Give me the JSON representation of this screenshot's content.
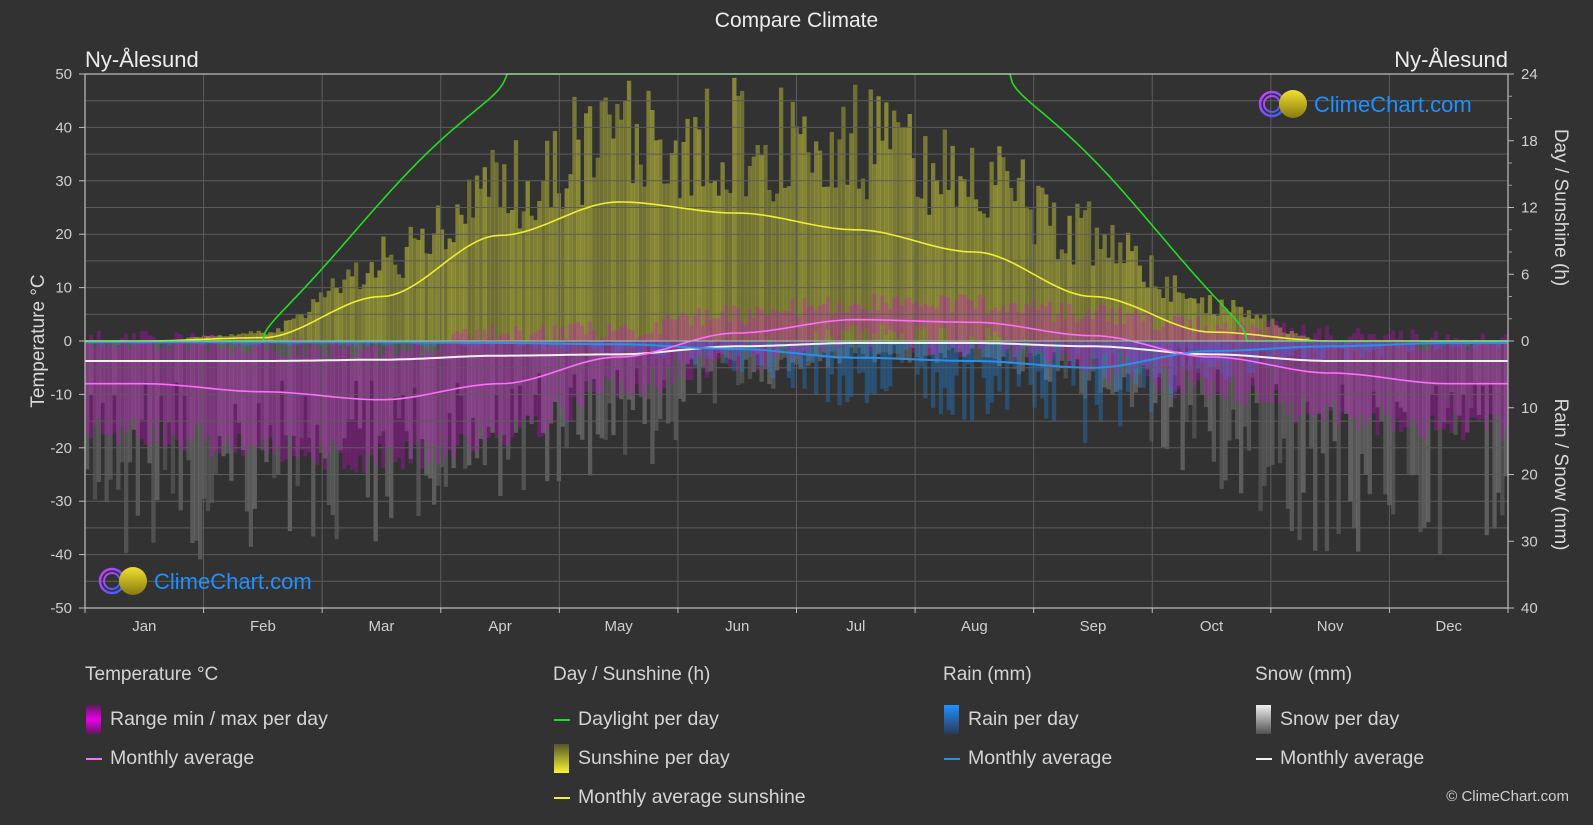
{
  "title": "Compare Climate",
  "location_left": "Ny-Ålesund",
  "location_right": "Ny-Ålesund",
  "watermark": "ClimeChart.com",
  "copyright": "© ClimeChart.com",
  "colors": {
    "background": "#323232",
    "grid": "#5a5a5a",
    "temperature_range": "#e000e0",
    "temperature_avg": "#ff6cff",
    "daylight": "#22dd22",
    "sunshine_bar": "#b8b83a",
    "sunshine_avg": "#eeee33",
    "rain_bar": "#1e88e5",
    "rain_avg": "#2a8fe6",
    "snow_bar": "#9a9a9a",
    "snow_avg": "#f0f0f0",
    "watermark_text": "#1e90ff"
  },
  "legend": {
    "temperature": {
      "title": "Temperature °C",
      "items": [
        {
          "label": "Range min / max per day",
          "type": "box"
        },
        {
          "label": "Monthly average",
          "type": "line"
        }
      ]
    },
    "sunshine": {
      "title": "Day / Sunshine (h)",
      "items": [
        {
          "label": "Daylight per day",
          "type": "line"
        },
        {
          "label": "Sunshine per day",
          "type": "box"
        },
        {
          "label": "Monthly average sunshine",
          "type": "line"
        }
      ]
    },
    "rain": {
      "title": "Rain (mm)",
      "items": [
        {
          "label": "Rain per day",
          "type": "box"
        },
        {
          "label": "Monthly average",
          "type": "line"
        }
      ]
    },
    "snow": {
      "title": "Snow (mm)",
      "items": [
        {
          "label": "Snow per day",
          "type": "box"
        },
        {
          "label": "Monthly average",
          "type": "line"
        }
      ]
    }
  },
  "chart_data": {
    "type": "line",
    "title": "Compare Climate",
    "categories": [
      "Jan",
      "Feb",
      "Mar",
      "Apr",
      "May",
      "Jun",
      "Jul",
      "Aug",
      "Sep",
      "Oct",
      "Nov",
      "Dec"
    ],
    "axes": {
      "left": {
        "label": "Temperature °C",
        "range": [
          -50,
          50
        ],
        "ticks": [
          50,
          40,
          30,
          20,
          10,
          0,
          -10,
          -20,
          -30,
          -40,
          -50
        ]
      },
      "right_top": {
        "label": "Day / Sunshine (h)",
        "range": [
          0,
          24
        ],
        "ticks": [
          24,
          18,
          12,
          6,
          0
        ]
      },
      "right_bottom": {
        "label": "Rain / Snow (mm)",
        "range": [
          0,
          40
        ],
        "ticks": [
          0,
          10,
          20,
          30,
          40
        ]
      }
    },
    "grid": true,
    "series": [
      {
        "name": "Temperature monthly average",
        "axis": "left",
        "unit": "°C",
        "values": [
          -8,
          -9.5,
          -11,
          -8,
          -3,
          1.5,
          4,
          3.5,
          1,
          -3,
          -6,
          -8
        ]
      },
      {
        "name": "Temperature daily range (approx. min)",
        "axis": "left",
        "unit": "°C",
        "values": [
          -17,
          -20,
          -22,
          -18,
          -9,
          -3,
          1,
          0,
          -4,
          -9,
          -14,
          -16
        ]
      },
      {
        "name": "Temperature daily range (approx. max)",
        "axis": "left",
        "unit": "°C",
        "values": [
          0,
          -1,
          -2,
          1,
          2,
          5,
          7,
          7,
          5,
          3,
          1,
          0
        ]
      },
      {
        "name": "Daylight per day",
        "axis": "right_top",
        "unit": "h",
        "values": [
          0,
          1.5,
          11,
          20,
          24,
          24,
          24,
          24,
          15,
          4,
          0,
          0
        ]
      },
      {
        "name": "Sunshine per day (approx. peak)",
        "axis": "right_top",
        "unit": "h",
        "values": [
          0,
          1,
          9,
          17,
          23,
          23,
          22,
          18,
          12,
          4,
          0,
          0
        ]
      },
      {
        "name": "Monthly average sunshine",
        "axis": "right_top",
        "unit": "h",
        "values": [
          0,
          0.3,
          4,
          9.5,
          12.5,
          11.5,
          10,
          8,
          4,
          0.8,
          0,
          0
        ]
      },
      {
        "name": "Rain monthly average",
        "axis": "right_bottom",
        "unit": "mm",
        "values": [
          0.2,
          0.2,
          0.2,
          0.3,
          0.5,
          1.2,
          2.5,
          3,
          4,
          1.5,
          0.8,
          0.3
        ]
      },
      {
        "name": "Snow monthly average",
        "axis": "right_bottom",
        "unit": "mm",
        "values": [
          3,
          3,
          2.8,
          2.2,
          2,
          0.8,
          0.3,
          0.3,
          0.8,
          2,
          3,
          3
        ]
      }
    ],
    "daylight_curve": {
      "polar_night_end_month_fraction": 1.5,
      "midnight_sun_start_month_fraction": 3.55,
      "midnight_sun_end_month_fraction": 7.8,
      "polar_night_start_month_fraction": 9.8
    }
  }
}
